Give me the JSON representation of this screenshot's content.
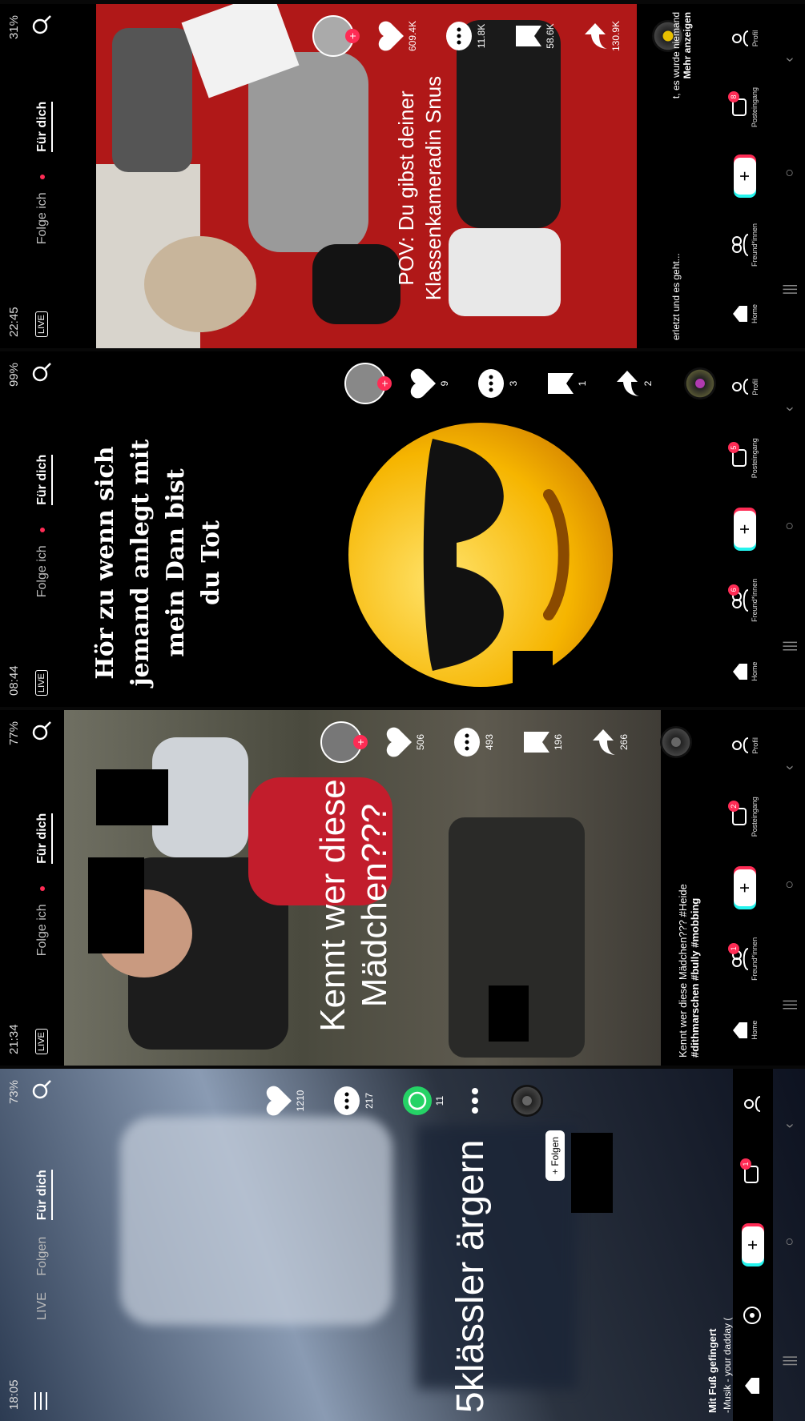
{
  "panels": [
    {
      "status": {
        "time": "18:05",
        "indicators": "73%"
      },
      "nav": {
        "live": "LIVE",
        "following": "Folgen",
        "for_you": "Für dich"
      },
      "overlay": "5klässler ärgern",
      "rail": {
        "likes": "1210",
        "comments": "217",
        "shares": "11"
      },
      "follow_button": "+ Folgen",
      "caption": {
        "title": "Mit Fuß gefingert",
        "music": "-Musik - your dadday  ("
      },
      "bottom_nav": {
        "inbox_badge": "1"
      }
    },
    {
      "status": {
        "time": "21:34",
        "indicators": "77%"
      },
      "nav": {
        "live": "LIVE",
        "following": "Folge ich",
        "for_you": "Für dich"
      },
      "overlay": "Kennt wer diese Mädchen???",
      "rail": {
        "likes": "506",
        "comments": "493",
        "saves": "196",
        "shares": "266"
      },
      "caption": {
        "line1": "Kennt wer diese Mädchen??? #Heide",
        "line2": "#dithmarschen #bully #mobbing"
      },
      "bottom_nav": {
        "home": "Home",
        "friends": "Freund*innen",
        "inbox": "Posteingang",
        "profile": "Profil",
        "friends_badge": "1",
        "inbox_badge": "2"
      }
    },
    {
      "status": {
        "time": "08:44",
        "indicators": "99%"
      },
      "nav": {
        "live": "LIVE",
        "following": "Folge ich",
        "for_you": "Für dich"
      },
      "overlay": "Hör zu wenn sich jemand anlegt mit mein Dan bist du Tot",
      "overlay_lines": [
        "Hör zu wenn sich",
        "jemand anlegt mit mein Dan bist",
        "du Tot"
      ],
      "rail": {
        "likes": "9",
        "comments": "3",
        "saves": "1",
        "shares": "2"
      },
      "bottom_nav": {
        "home": "Home",
        "friends": "Freund*innen",
        "inbox": "Posteingang",
        "profile": "Profil",
        "friends_badge": "6",
        "inbox_badge": "5"
      }
    },
    {
      "status": {
        "time": "22:45",
        "indicators": "31%"
      },
      "nav": {
        "live": "LIVE",
        "following": "Folge ich",
        "for_you": "Für dich"
      },
      "overlay_lines": [
        "POV: Du gibst deiner",
        "Klassenkameradin Snus"
      ],
      "rail": {
        "likes": "609.4K",
        "comments": "11.8K",
        "saves": "58.6K",
        "shares": "130.9K"
      },
      "caption": {
        "left": "erletzt und es geht...",
        "right": "t, es wurde niemand",
        "more": "Mehr anzeigen"
      },
      "bottom_nav": {
        "home": "Home",
        "friends": "Freund*innen",
        "inbox": "Posteingang",
        "profile": "Profil",
        "inbox_badge": "8"
      }
    }
  ],
  "colors": {
    "accent": "#fe2c55",
    "teal": "#25f4ee",
    "carpet": "#b01818",
    "emoji": "#f6b500"
  }
}
